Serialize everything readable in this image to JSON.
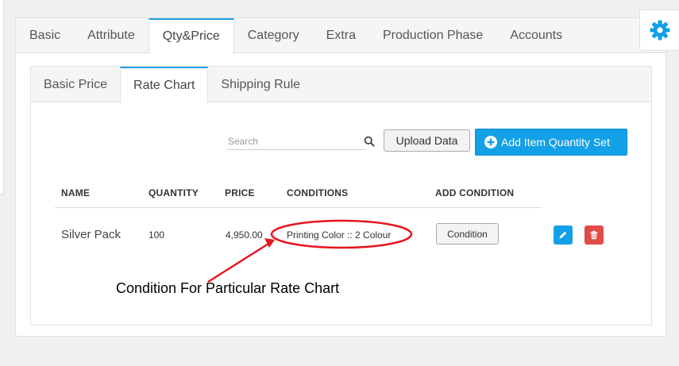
{
  "main_tabs": [
    "Basic",
    "Attribute",
    "Qty&Price",
    "Category",
    "Extra",
    "Production Phase",
    "Accounts"
  ],
  "active_main_tab": "Qty&Price",
  "sub_tabs": [
    "Basic Price",
    "Rate Chart",
    "Shipping Rule"
  ],
  "active_sub_tab": "Rate Chart",
  "search": {
    "placeholder": "Search"
  },
  "toolbar": {
    "upload_label": "Upload Data",
    "add_label": "Add Item Quantity Set"
  },
  "table": {
    "headers": [
      "NAME",
      "QUANTITY",
      "PRICE",
      "CONDITIONS",
      "ADD CONDITION"
    ],
    "rows": [
      {
        "name": "Silver Pack",
        "quantity": "100",
        "price": "4,950.00",
        "conditions": "Printing Color :: 2 Colour",
        "condition_button": "Condition"
      }
    ]
  },
  "annotation": {
    "text": "Condition For Particular Rate Chart"
  },
  "colors": {
    "accent": "#13a0e6",
    "danger": "#e04b48",
    "highlight": "#e8141c"
  },
  "icons": [
    "gear-icon",
    "search-icon",
    "plus-circle-icon",
    "pencil-icon",
    "trash-icon"
  ]
}
